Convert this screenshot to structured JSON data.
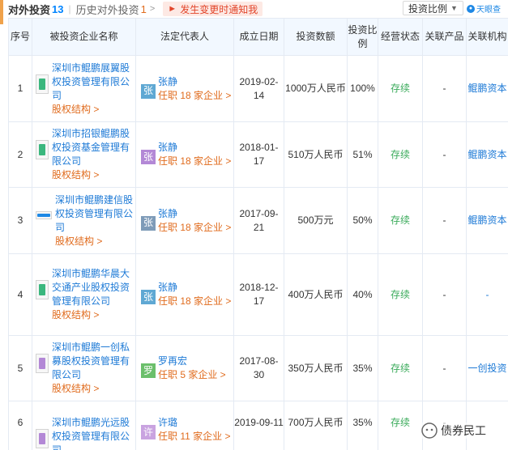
{
  "header": {
    "title": "对外投资",
    "count": "13",
    "history_label": "历史对外投资",
    "history_count": "1",
    "history_chevron": ">",
    "notify_label": "发生变更时通知我",
    "sort_label": "投资比例",
    "brand": "天眼查"
  },
  "columns": [
    "序号",
    "被投资企业名称",
    "法定代表人",
    "成立日期",
    "投资数额",
    "投资比例",
    "经营状态",
    "关联产品",
    "关联机构"
  ],
  "rows": [
    {
      "idx": "1",
      "name": "深圳市鲲鹏展翼股权投资管理有限公司",
      "stake": "股权结构 >",
      "rep_char": "张",
      "rep_name": "张静",
      "rep_job": "任职 18 家企业 >",
      "date": "2019-02-14",
      "amount": "1000万人民币",
      "ratio": "100%",
      "status": "存续",
      "product": "-",
      "org": "鲲鹏资本",
      "logo_color": "#3bb77e",
      "avatar_color": "#5fa8d3"
    },
    {
      "idx": "2",
      "name": "深圳市招银鲲鹏股权投资基金管理有限公司",
      "stake": "股权结构 >",
      "rep_char": "张",
      "rep_name": "张静",
      "rep_job": "任职 18 家企业 >",
      "date": "2018-01-17",
      "amount": "510万人民币",
      "ratio": "51%",
      "status": "存续",
      "product": "-",
      "org": "鲲鹏资本",
      "logo_color": "#3bb77e",
      "avatar_color": "#b388d6"
    },
    {
      "idx": "3",
      "name": "深圳市鲲鹏建信股权投资管理有限公司",
      "stake": "股权结构 >",
      "rep_char": "张",
      "rep_name": "张静",
      "rep_job": "任职 18 家企业 >",
      "date": "2017-09-21",
      "amount": "500万元",
      "ratio": "50%",
      "status": "存续",
      "product": "-",
      "org": "鲲鹏资本",
      "logo_color": "#1e88e5",
      "avatar_color": "#7e9bb8"
    },
    {
      "idx": "4",
      "name": "深圳市鲲鹏华晨大交通产业股权投资管理有限公司",
      "stake": "股权结构 >",
      "rep_char": "张",
      "rep_name": "张静",
      "rep_job": "任职 18 家企业 >",
      "date": "2018-12-17",
      "amount": "400万人民币",
      "ratio": "40%",
      "status": "存续",
      "product": "-",
      "org": "-",
      "logo_color": "#3bb77e",
      "avatar_color": "#5fa8d3"
    },
    {
      "idx": "5",
      "name": "深圳市鲲鹏一创私募股权投资管理有限公司",
      "stake": "股权结构 >",
      "rep_char": "罗",
      "rep_name": "罗再宏",
      "rep_job": "任职 5 家企业 >",
      "date": "2017-08-30",
      "amount": "350万人民币",
      "ratio": "35%",
      "status": "存续",
      "product": "-",
      "org": "一创投资",
      "logo_color": "#b388d6",
      "avatar_color": "#6bbf6b"
    },
    {
      "idx": "6",
      "name": "深圳市鲲鹏光远股权投资管理有限公司",
      "stake": "",
      "rep_char": "许",
      "rep_name": "许璐",
      "rep_job": "任职 11 家企业 >",
      "date": "2019-09-11",
      "amount": "700万人民币",
      "ratio": "35%",
      "status": "存续",
      "product": "-",
      "org": "",
      "logo_color": "#b388d6",
      "avatar_color": "#c9a3e0"
    }
  ],
  "watermark": "债券民工"
}
